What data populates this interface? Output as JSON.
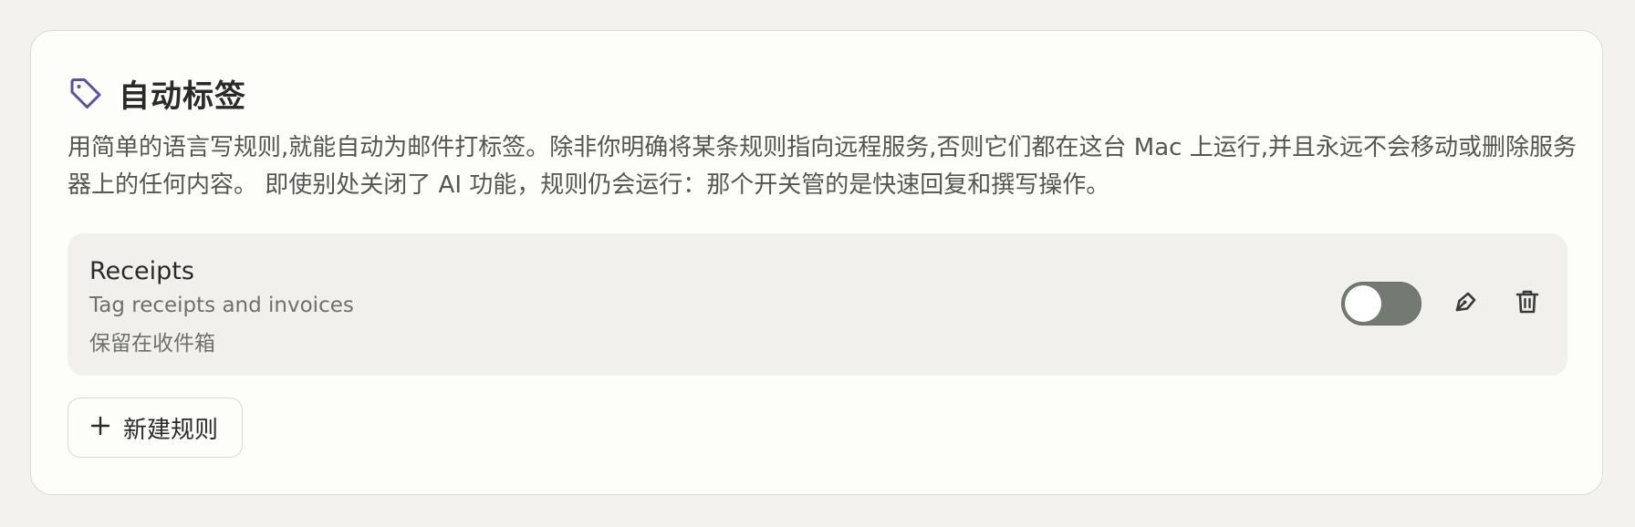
{
  "section": {
    "title": "自动标签",
    "icon": "tag-icon",
    "accent_color": "#5b4fa3",
    "description": "用简单的语言写规则,就能自动为邮件打标签。除非你明确将某条规则指向远程服务,否则它们都在这台 Mac 上运行,并且永远不会移动或删除服务器上的任何内容。 即使别处关闭了 AI 功能，规则仍会运行：那个开关管的是快速回复和撰写操作。"
  },
  "rules": [
    {
      "name": "Receipts",
      "description": "Tag receipts and invoices",
      "action": "保留在收件箱",
      "enabled": false,
      "toggle_color": "#737a72",
      "edit_icon": "pen-icon",
      "delete_icon": "trash-icon"
    }
  ],
  "actions": {
    "new_rule_label": "新建规则",
    "new_rule_icon": "plus-icon"
  }
}
